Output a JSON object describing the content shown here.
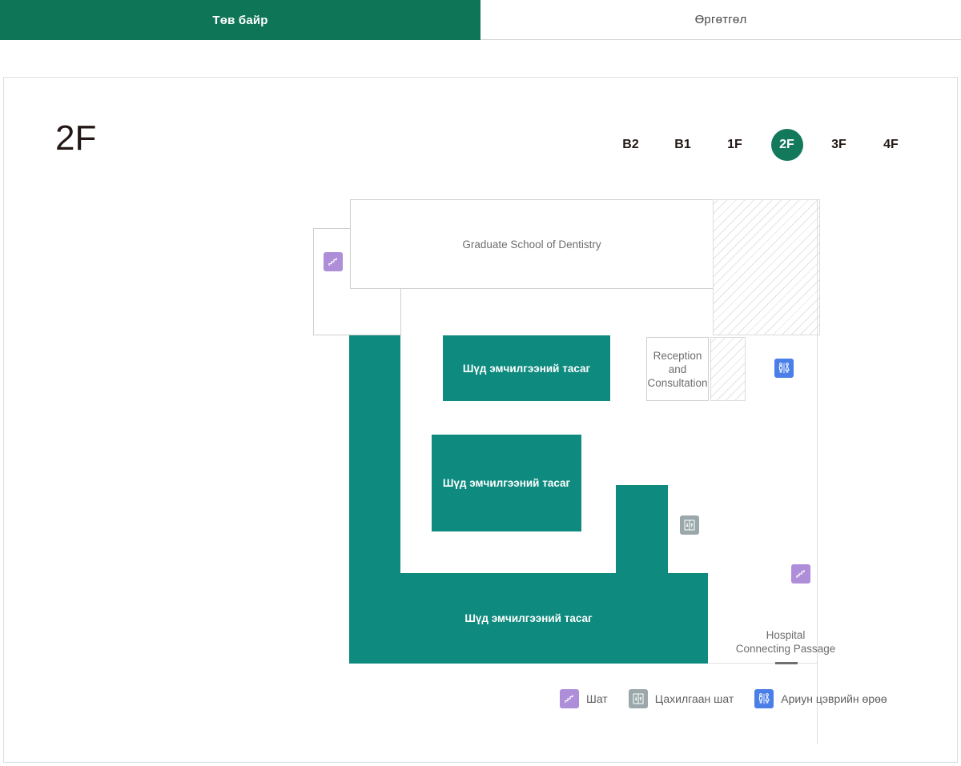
{
  "tabs": [
    {
      "label": "Төв байр",
      "active": true
    },
    {
      "label": "Өргөтгөл",
      "active": false
    }
  ],
  "floor": {
    "current_label": "2F",
    "options": [
      "B2",
      "B1",
      "1F",
      "2F",
      "3F",
      "4F"
    ],
    "selected": "2F",
    "accent_color": "#13795B"
  },
  "map": {
    "rooms": [
      {
        "name": "graduate-school-of-dentistry",
        "label": "Graduate School of Dentistry",
        "style": "outline"
      },
      {
        "name": "stairwell-block-northwest",
        "label": "",
        "style": "outline"
      },
      {
        "name": "hatched-area-northeast",
        "label": "",
        "style": "hatch"
      },
      {
        "name": "dental-treatment-ward-upper",
        "label": "Шүд эмчилгээний тасаг",
        "style": "teal"
      },
      {
        "name": "reception-and-consultation",
        "label": "Reception and\nConsultation",
        "style": "outline"
      },
      {
        "name": "hatched-area-reception-side",
        "label": "",
        "style": "hatch"
      },
      {
        "name": "dental-treatment-ward-middle",
        "label": "Шүд эмчилгээний тасаг",
        "style": "teal"
      },
      {
        "name": "dental-treatment-ward-lower",
        "label": "Шүд эмчилгээний тасаг",
        "style": "teal"
      },
      {
        "name": "hospital-connecting-passage",
        "label": "Hospital\nConnecting Passage",
        "style": "plain"
      }
    ],
    "icons": [
      {
        "name": "stairs-icon-northwest",
        "type": "stairs"
      },
      {
        "name": "restroom-icon-map",
        "type": "restroom"
      },
      {
        "name": "elevator-icon-map",
        "type": "elevator"
      },
      {
        "name": "stairs-icon-southeast",
        "type": "stairs"
      }
    ]
  },
  "legend": {
    "items": [
      {
        "icon": "stairs-icon",
        "label": "Шат",
        "color": "#AE8ED8"
      },
      {
        "icon": "elevator-icon",
        "label": "Цахилгаан шат",
        "color": "#9AA8AB"
      },
      {
        "icon": "restroom-icon",
        "label": "Ариун цэврийн өрөө",
        "color": "#4A7FE8"
      }
    ]
  }
}
